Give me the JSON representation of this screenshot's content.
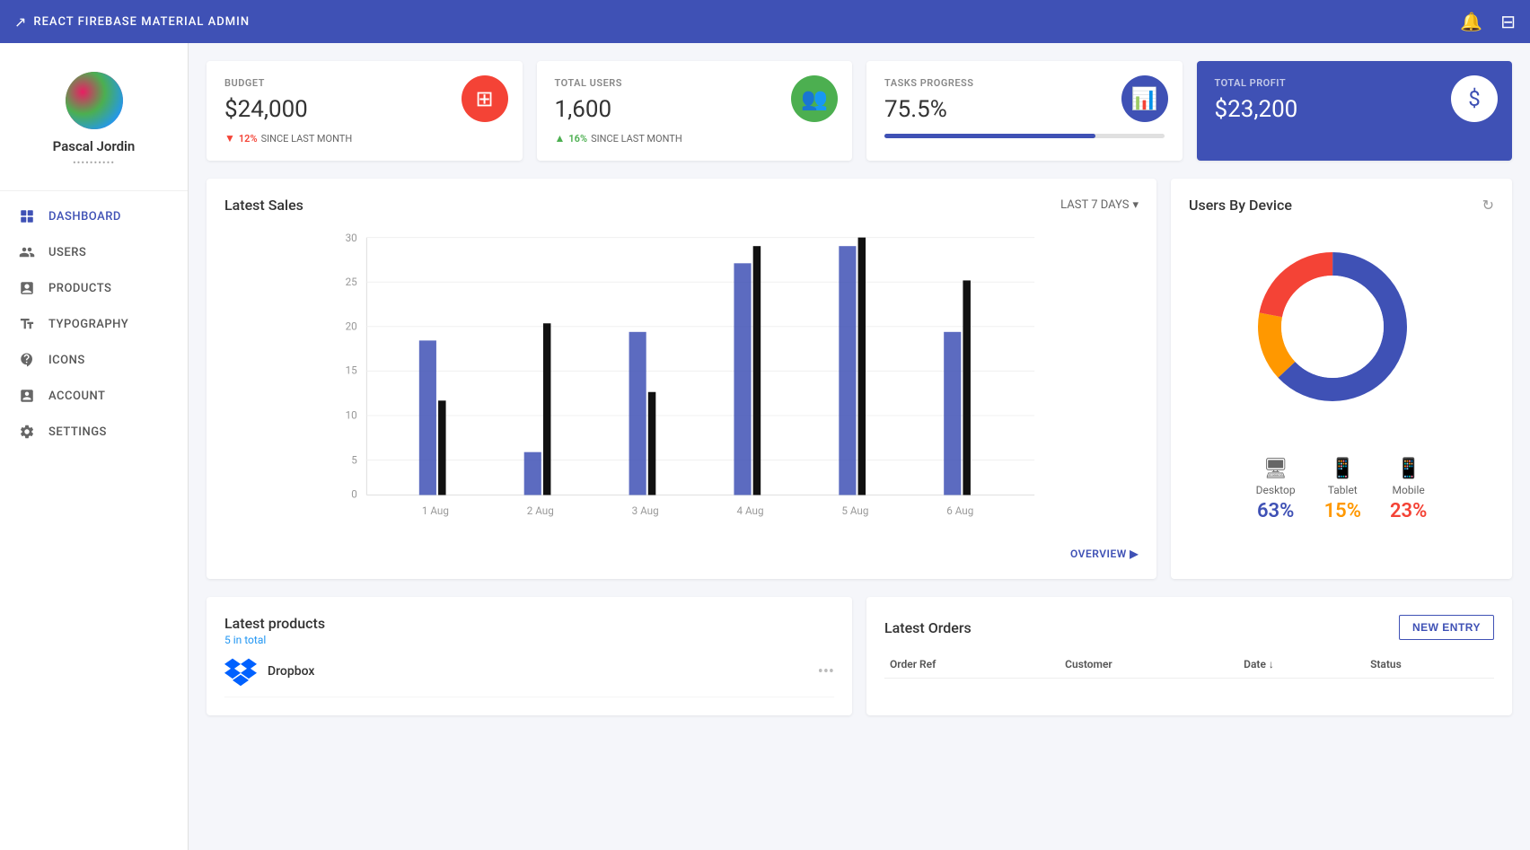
{
  "app": {
    "title": "REACT FIREBASE MATERIAL ADMIN"
  },
  "topnav": {
    "title": "REACT FIREBASE MATERIAL ADMIN",
    "bell_icon": "🔔",
    "logout_icon": "⎋"
  },
  "sidebar": {
    "user": {
      "name": "Pascal Jordin",
      "role": "••••••••••"
    },
    "nav_items": [
      {
        "id": "dashboard",
        "label": "DASHBOARD",
        "icon": "dashboard",
        "active": true
      },
      {
        "id": "users",
        "label": "USERS",
        "icon": "users"
      },
      {
        "id": "products",
        "label": "PRODUCTS",
        "icon": "products"
      },
      {
        "id": "typography",
        "label": "TYPOGRAPHY",
        "icon": "typography"
      },
      {
        "id": "icons",
        "label": "ICONS",
        "icon": "icons"
      },
      {
        "id": "account",
        "label": "ACCOUNT",
        "icon": "account"
      },
      {
        "id": "settings",
        "label": "SETTINGS",
        "icon": "settings"
      }
    ]
  },
  "stats": {
    "budget": {
      "label": "BUDGET",
      "value": "$24,000",
      "sub_pct": "12%",
      "sub_text": "SINCE LAST MONTH",
      "trend": "down"
    },
    "total_users": {
      "label": "TOTAL USERS",
      "value": "1,600",
      "sub_pct": "16%",
      "sub_text": "SINCE LAST MONTH",
      "trend": "up"
    },
    "tasks_progress": {
      "label": "TASKS PROGRESS",
      "value": "75.5%",
      "progress": 75.5
    },
    "total_profit": {
      "label": "TOTAL PROFIT",
      "value": "$23,200"
    }
  },
  "sales_chart": {
    "title": "Latest Sales",
    "period": "LAST 7 DAYS",
    "overview_label": "OVERVIEW ▶",
    "y_axis": [
      0,
      5,
      10,
      15,
      20,
      25,
      30
    ],
    "bars": [
      {
        "date": "1 Aug",
        "blue": 18,
        "black": 11
      },
      {
        "date": "2 Aug",
        "blue": 5,
        "black": 20
      },
      {
        "date": "3 Aug",
        "blue": 19,
        "black": 12
      },
      {
        "date": "4 Aug",
        "blue": 27,
        "black": 29
      },
      {
        "date": "5 Aug",
        "blue": 29,
        "black": 30
      },
      {
        "date": "6 Aug",
        "blue": 19,
        "black": 25
      }
    ]
  },
  "devices_chart": {
    "title": "Users By Device",
    "desktop": {
      "label": "Desktop",
      "pct": "63%",
      "value": 63
    },
    "tablet": {
      "label": "Tablet",
      "pct": "15%",
      "value": 15
    },
    "mobile": {
      "label": "Mobile",
      "pct": "23%",
      "value": 23
    }
  },
  "latest_products": {
    "title": "Latest products",
    "sub": "5 in total",
    "items": [
      {
        "name": "Dropbox",
        "logo_color": "#0061FF"
      }
    ]
  },
  "latest_orders": {
    "title": "Latest Orders",
    "new_entry_label": "NEW ENTRY",
    "columns": [
      "Order Ref",
      "Customer",
      "Date ↓",
      "Status"
    ],
    "rows": []
  }
}
